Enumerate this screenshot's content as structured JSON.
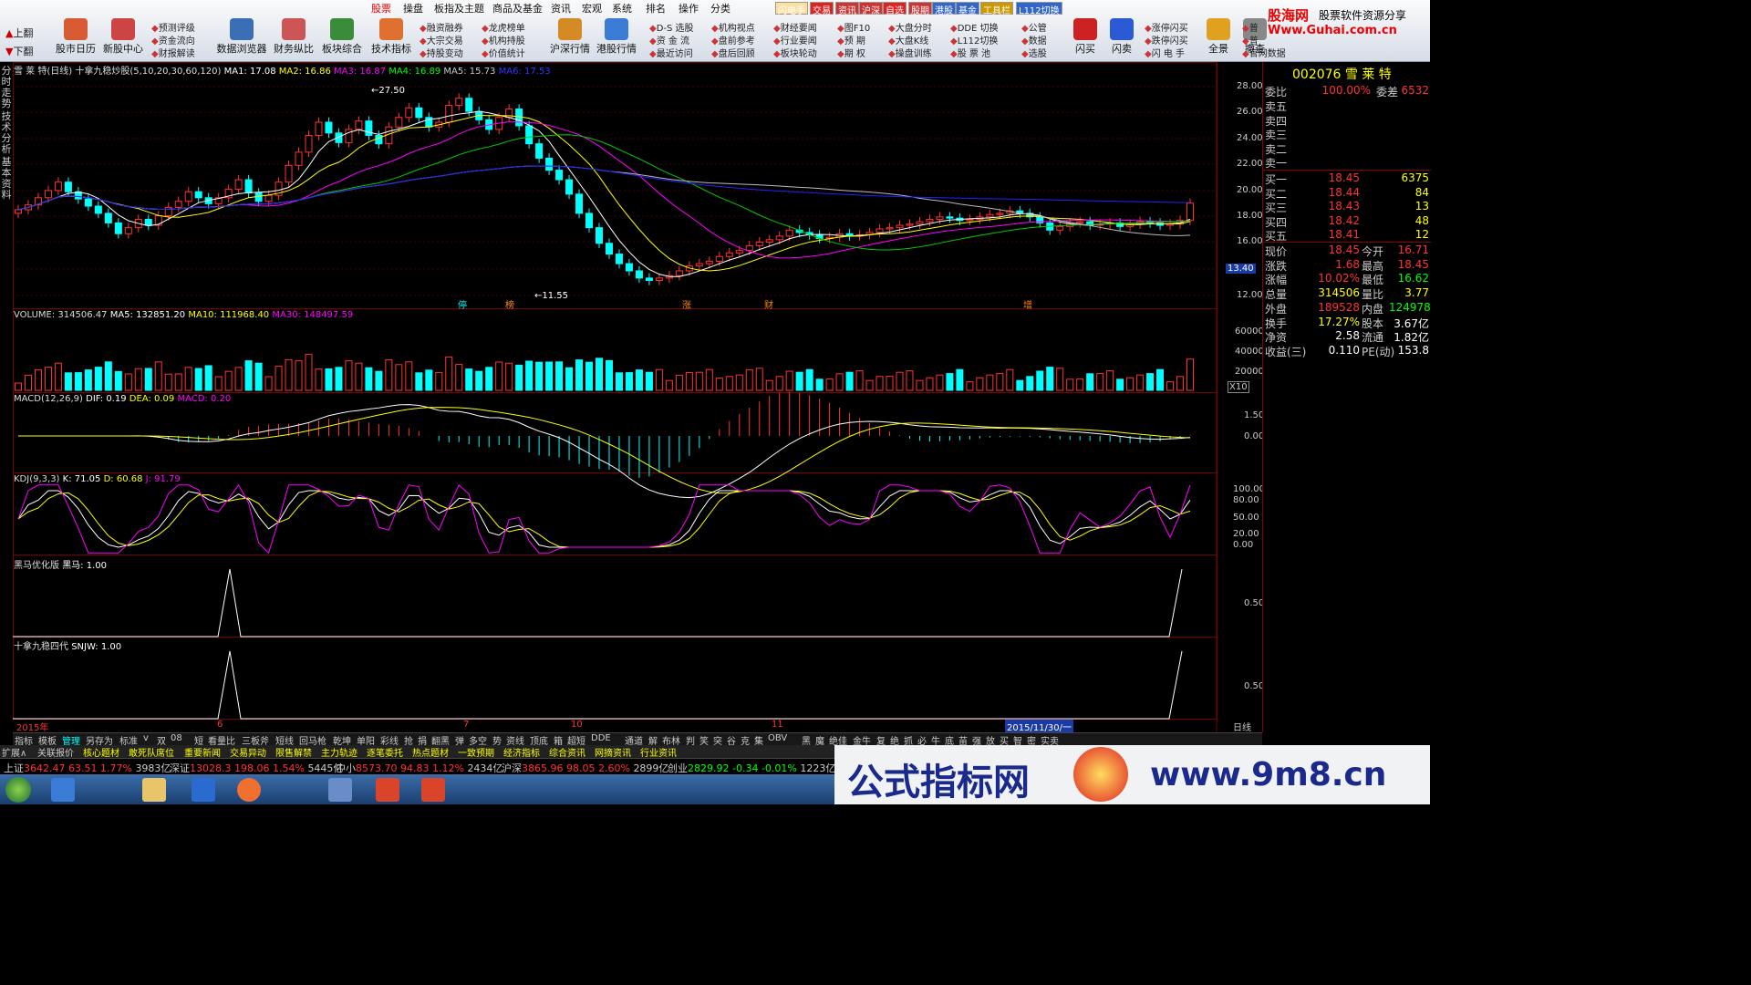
{
  "menu_tabs": [
    "股票",
    "操盘",
    "板指及主题",
    "商品及基金",
    "资讯",
    "宏观",
    "系统",
    "排名",
    "操作",
    "分类"
  ],
  "active_tab": "股票",
  "right_tabs": [
    "闪电手",
    "交易",
    "资讯",
    "沪深",
    "自选",
    "股期",
    "港股",
    "基金",
    "工具栏",
    "L112切换"
  ],
  "brand": {
    "title": "股海网",
    "subtitle": "股票软件资源分享",
    "url": "Www.Guhai.com.cn"
  },
  "toolbar": {
    "page_up": "上翻",
    "page_down": "下翻",
    "big_buttons": [
      "股市日历",
      "新股中心",
      "数据浏览器",
      "财务纵比",
      "板块综合",
      "技术指标",
      "沪深行情",
      "港股行情",
      "闪买",
      "闪卖",
      "全景",
      "撤查"
    ],
    "small_col1": [
      "预测评级",
      "资金流向",
      "财报解读"
    ],
    "small_col2": [
      "融资融券",
      "大宗交易",
      "持股变动"
    ],
    "small_col3": [
      "龙虎榜单",
      "机构持股",
      "价值统计"
    ],
    "small_col4": [
      "D-S 选股",
      "资 金 流",
      "最近访问"
    ],
    "small_col5": [
      "机构视点",
      "盘前参考",
      "盘后回顾"
    ],
    "small_col6": [
      "财经要闻",
      "行业要闻",
      "板块轮动"
    ],
    "small_col7": [
      "图F10",
      "预 期",
      "期 权"
    ],
    "small_col8": [
      "大盘分时",
      "大盘K线",
      "操盘训练"
    ],
    "small_col9": [
      "DDE 切换",
      "L112切换",
      "股 票 池"
    ],
    "small_col10": [
      "公管",
      "数据",
      "选股"
    ],
    "small_col11": [
      "涨停闪买",
      "跌停闪买",
      "闪 电 手"
    ],
    "small_col12": [
      "普",
      "普",
      "官网数据"
    ]
  },
  "left_vtabs": [
    "分时走势",
    "技术分析",
    "基本资料"
  ],
  "main_chart": {
    "header": {
      "stock": "雪 莱 特(日线)",
      "formula": "十拿九稳炒股(5,10,20,30,60,120)",
      "ma1": "MA1: 17.08",
      "ma2": "MA2: 16.86",
      "ma3": "MA3: 16.87",
      "ma4": "MA4: 16.89",
      "ma5": "MA5: 15.73",
      "ma6": "MA6: 17.53"
    },
    "ticks": [
      "28.00",
      "26.00",
      "24.00",
      "22.00",
      "20.00",
      "18.00",
      "16.00",
      "13.40",
      "12.00"
    ],
    "hi_label": "27.50",
    "lo_label": "11.55",
    "markers": [
      "停",
      "榜",
      "涨",
      "财",
      "增"
    ]
  },
  "volume_chart": {
    "header": {
      "name": "VOLUME: 314506.47",
      "ma5": "MA5: 132851.20",
      "ma10": "MA10: 111968.40",
      "ma30": "MA30: 148497.59"
    },
    "ticks": [
      "60000",
      "40000",
      "20000"
    ],
    "unit": "X10"
  },
  "macd_chart": {
    "header": {
      "name": "MACD(12,26,9)",
      "dif": "DIF: 0.19",
      "dea": "DEA: 0.09",
      "macd": "MACD: 0.20"
    },
    "ticks": [
      "1.50",
      "0.00"
    ]
  },
  "kdj_chart": {
    "header": {
      "name": "KDJ(9,3,3)",
      "k": "K: 71.05",
      "d": "D: 60.68",
      "j": "J: 91.79"
    },
    "ticks": [
      "100.00",
      "80.00",
      "50.00",
      "20.00",
      "0.00"
    ]
  },
  "hm_chart": {
    "header": {
      "name": "黑马优化版",
      "val": "黑马: 1.00"
    },
    "ticks": [
      "0.50"
    ]
  },
  "snjw_chart": {
    "header": {
      "name": "十拿九稳四代",
      "val": "SNJW: 1.00"
    },
    "ticks": [
      "0.50"
    ]
  },
  "date_axis": {
    "labels": [
      "2015年",
      "6",
      "7",
      "10",
      "11"
    ],
    "cursor": "2015/11/30/一",
    "period": "日线"
  },
  "right_panel": {
    "code": "002076",
    "name": "雪 莱 特",
    "wb_label": "委比",
    "wb_val": "100.00%",
    "wc_label": "委差",
    "wc_val": "6532",
    "sell": [
      {
        "k": "卖五",
        "p": "",
        "v": ""
      },
      {
        "k": "卖四",
        "p": "",
        "v": ""
      },
      {
        "k": "卖三",
        "p": "",
        "v": ""
      },
      {
        "k": "卖二",
        "p": "",
        "v": ""
      },
      {
        "k": "卖一",
        "p": "",
        "v": ""
      }
    ],
    "buy": [
      {
        "k": "买一",
        "p": "18.45",
        "v": "6375"
      },
      {
        "k": "买二",
        "p": "18.44",
        "v": "84"
      },
      {
        "k": "买三",
        "p": "18.43",
        "v": "13"
      },
      {
        "k": "买四",
        "p": "18.42",
        "v": "48"
      },
      {
        "k": "买五",
        "p": "18.41",
        "v": "12"
      }
    ],
    "stats": [
      {
        "k1": "现价",
        "v1": "18.45",
        "k2": "今开",
        "v2": "16.71"
      },
      {
        "k1": "涨跌",
        "v1": "1.68",
        "k2": "最高",
        "v2": "18.45"
      },
      {
        "k1": "涨幅",
        "v1": "10.02%",
        "k2": "最低",
        "v2": "16.62"
      },
      {
        "k1": "总量",
        "v1": "314506",
        "k2": "量比",
        "v2": "3.77"
      },
      {
        "k1": "外盘",
        "v1": "189528",
        "k2": "内盘",
        "v2": "124978"
      },
      {
        "k1": "换手",
        "v1": "17.27%",
        "k2": "股本",
        "v2": "3.67亿"
      },
      {
        "k1": "净资",
        "v1": "2.58",
        "k2": "流通",
        "v2": "1.82亿"
      },
      {
        "k1": "收益(三)",
        "v1": "0.110",
        "k2": "PE(动)",
        "v2": "153.8"
      }
    ]
  },
  "bottom_tabs": [
    "指标",
    "模板",
    "管理",
    "另存为",
    "标准",
    "v",
    "双",
    "08",
    "短",
    "看量比",
    "三板斧",
    "短线",
    "回马枪",
    "乾坤",
    "单阳",
    "彩线",
    "抢",
    "捐",
    "翻黑",
    "弹",
    "多空",
    "势",
    "资线",
    "顶底",
    "箱",
    "超短",
    "DDE",
    "通道",
    "解",
    "布林",
    "判",
    "笑",
    "突",
    "谷",
    "克",
    "集",
    "OBV",
    "黑",
    "魔",
    "绝佳",
    "金牛",
    "复",
    "绝",
    "抓",
    "必",
    "牛",
    "底",
    "苗",
    "强",
    "放",
    "买",
    "智",
    "密",
    "实卖"
  ],
  "tab_bar2": [
    "扩展∧",
    "关联报价",
    "核心题材",
    "敢死队席位",
    "重要新闻",
    "交易异动",
    "限售解禁",
    "主力轨迹",
    "逐笔委托",
    "热点题材",
    "一致预期",
    "经济指标",
    "综合资讯",
    "网摘资讯",
    "行业资讯"
  ],
  "index_bar": [
    {
      "n": "上证",
      "v": "3642.47",
      "c": "63.51",
      "p": "1.77%",
      "a": "3983亿"
    },
    {
      "n": "深证",
      "v": "13028.3",
      "c": "198.06",
      "p": "1.54%",
      "a": "5445亿"
    },
    {
      "n": "中小",
      "v": "8573.70",
      "c": "94.83",
      "p": "1.12%",
      "a": "2434亿"
    },
    {
      "n": "沪深",
      "v": "3865.96",
      "c": "98.05",
      "p": "2.60%",
      "a": "2899亿"
    },
    {
      "n": "创业",
      "v": "2829.92",
      "c": "-0.34",
      "p": "-0.01%",
      "a": "1223亿"
    }
  ],
  "banner": {
    "text": "公式指标网",
    "url": "www.9m8.cn"
  }
}
